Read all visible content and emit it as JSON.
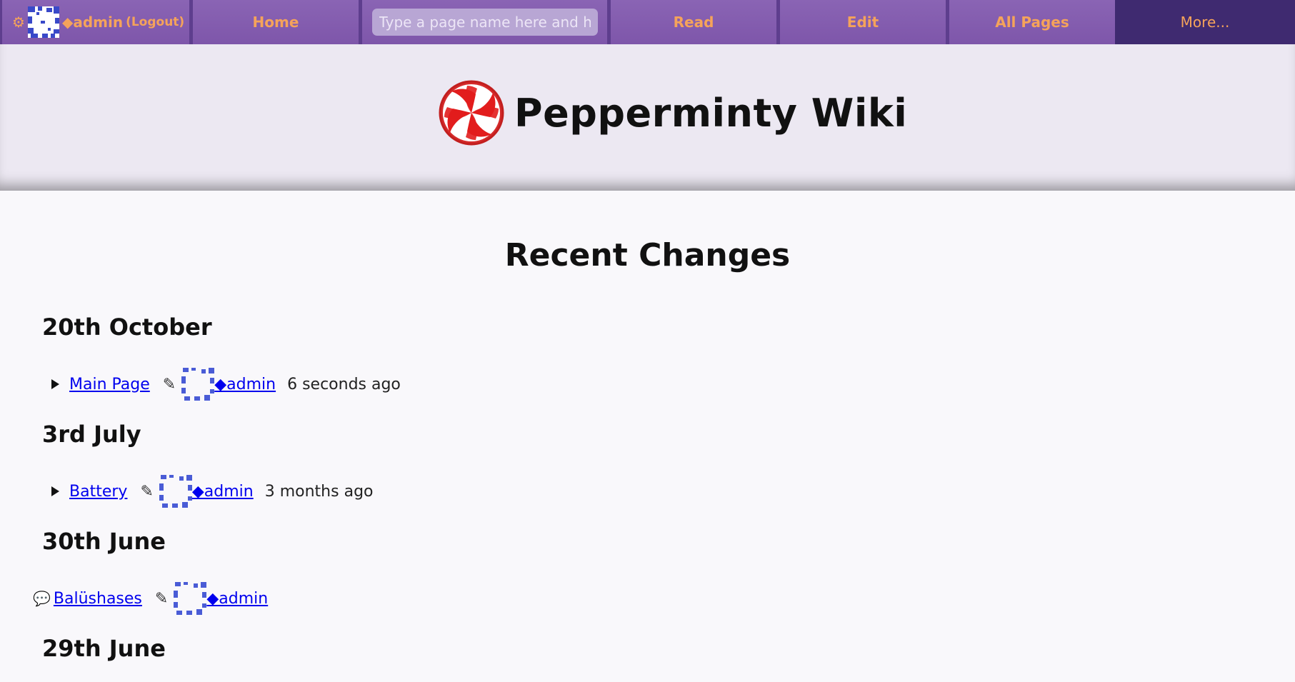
{
  "nav": {
    "settings_icon": "gear-icon",
    "user_name": "◆admin",
    "logout_label": "(Logout)",
    "home_label": "Home",
    "search_placeholder": "Type a page name here and h",
    "read_label": "Read",
    "edit_label": "Edit",
    "all_pages_label": "All Pages",
    "more_label": "More..."
  },
  "header": {
    "site_title": "Pepperminty Wiki"
  },
  "main": {
    "page_title": "Recent Changes",
    "days": [
      {
        "heading": "20th October",
        "changes": [
          {
            "type": "edit",
            "page": "Main Page",
            "user": "◆admin",
            "time": "6 seconds ago"
          }
        ]
      },
      {
        "heading": "3rd July",
        "changes": [
          {
            "type": "edit",
            "page": "Battery",
            "user": "◆admin",
            "time": "3 months ago"
          }
        ]
      },
      {
        "heading": "30th June",
        "changes": [
          {
            "type": "comment",
            "page": "Balüshases",
            "user": "◆admin",
            "time": ""
          }
        ]
      },
      {
        "heading": "29th June",
        "changes": []
      }
    ]
  },
  "colors": {
    "nav_bg": "#8a64b4",
    "nav_accent": "#f5a35a",
    "nav_dark": "#3f2a70",
    "link": "#0000ee",
    "header_bg": "#ece8f2"
  }
}
